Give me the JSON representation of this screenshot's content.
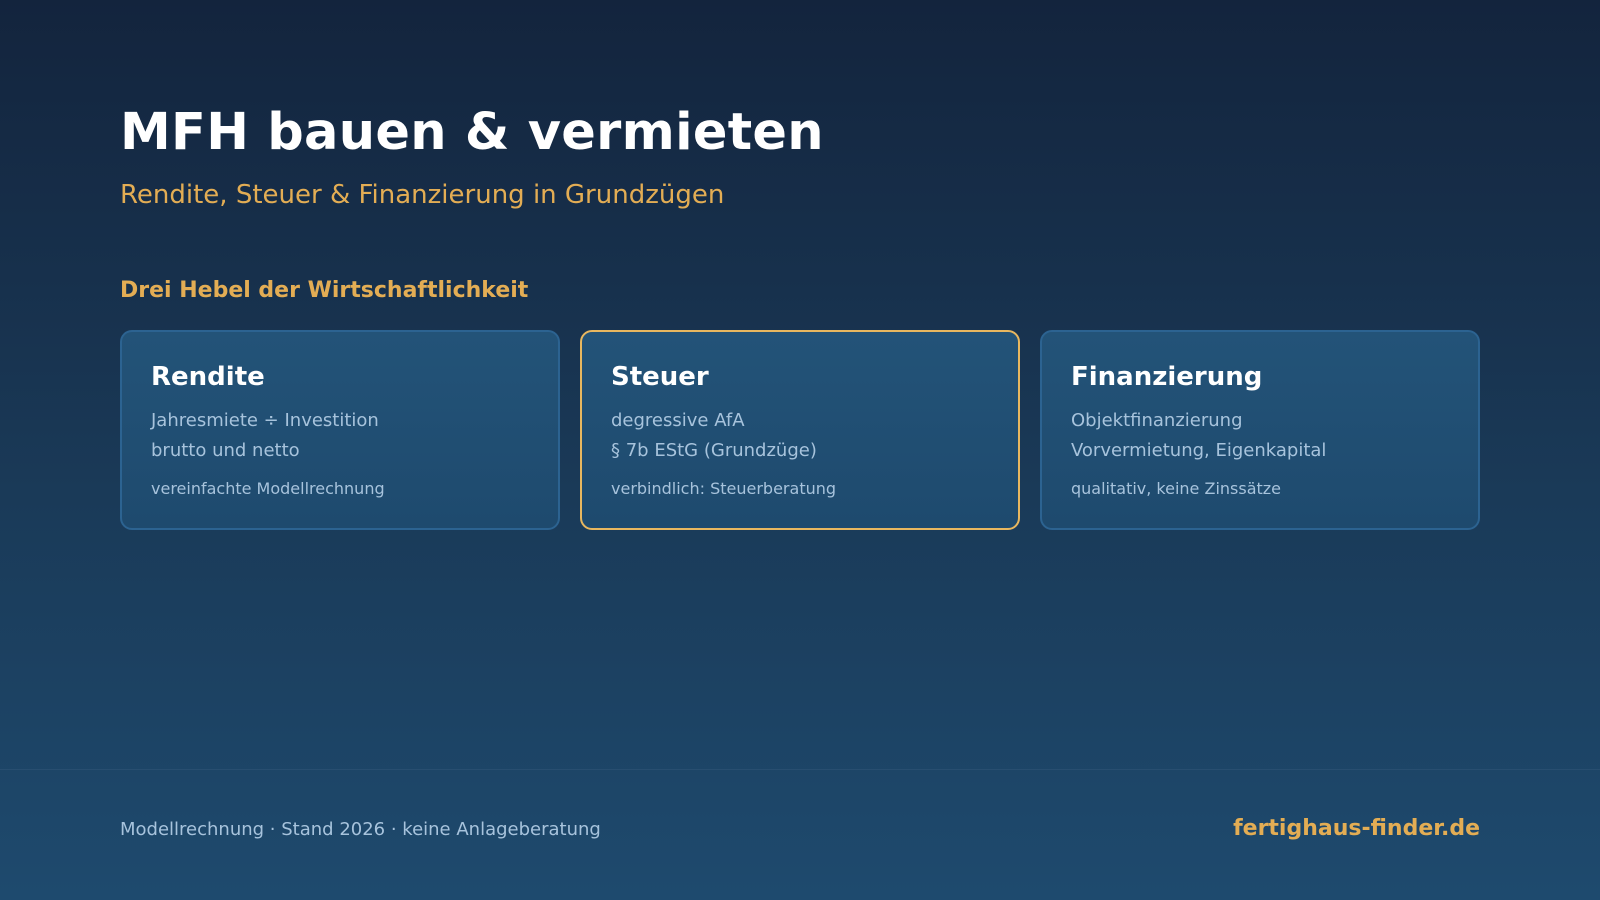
{
  "header": {
    "title": "MFH bauen & vermieten",
    "subtitle": "Rendite, Steuer & Finanzierung in Grundzügen"
  },
  "section": {
    "heading": "Drei Hebel der Wirtschaftlichkeit"
  },
  "cards": [
    {
      "title": "Rendite",
      "lines": [
        "Jahresmiete ÷ Investition",
        "brutto und netto"
      ],
      "note": "vereinfachte Modellrechnung",
      "highlighted": false
    },
    {
      "title": "Steuer",
      "lines": [
        "degressive AfA",
        "§ 7b EStG (Grundzüge)"
      ],
      "note": "verbindlich: Steuerberatung",
      "highlighted": true
    },
    {
      "title": "Finanzierung",
      "lines": [
        "Objektfinanzierung",
        "Vorvermietung, Eigenkapital"
      ],
      "note": "qualitativ, keine Zinssätze",
      "highlighted": false
    }
  ],
  "footer": {
    "disclaimer": "Modellrechnung · Stand 2026 · keine Anlageberatung",
    "brand": "fertighaus-finder.de"
  },
  "colors": {
    "accent": "#e3ad54",
    "highlight_border": "#e8b75f",
    "card_border": "#2c6391",
    "muted_text": "#a7c3dc",
    "background_top": "#13243d",
    "background_bottom": "#1e4a6e"
  }
}
